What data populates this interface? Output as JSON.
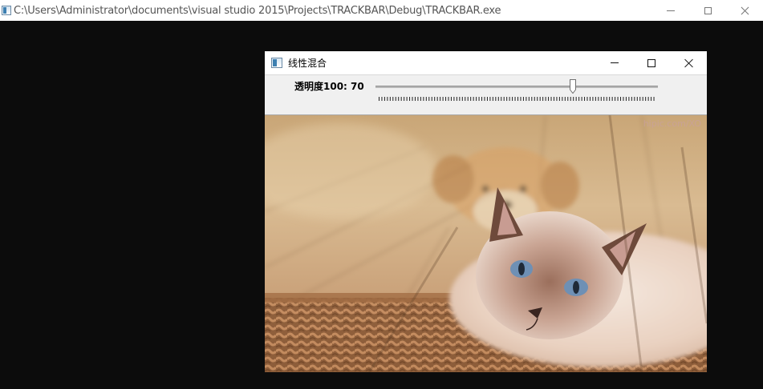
{
  "console": {
    "title": "C:\\Users\\Administrator\\documents\\visual studio 2015\\Projects\\TRACKBAR\\Debug\\TRACKBAR.exe",
    "icon": "console-app-icon"
  },
  "highgui_window": {
    "title": "线性混合",
    "icon": "window-app-icon",
    "trackbar": {
      "label": "透明度100: 70",
      "value": 70,
      "max": 100
    },
    "image": {
      "watermark": "hipic.com/XO",
      "content": "alpha blend of puppy over cat in wicker basket"
    }
  },
  "colors": {
    "console_background": "#0c0c0c",
    "titlebar": "#ffffff",
    "window_face": "#f0f0f0"
  }
}
